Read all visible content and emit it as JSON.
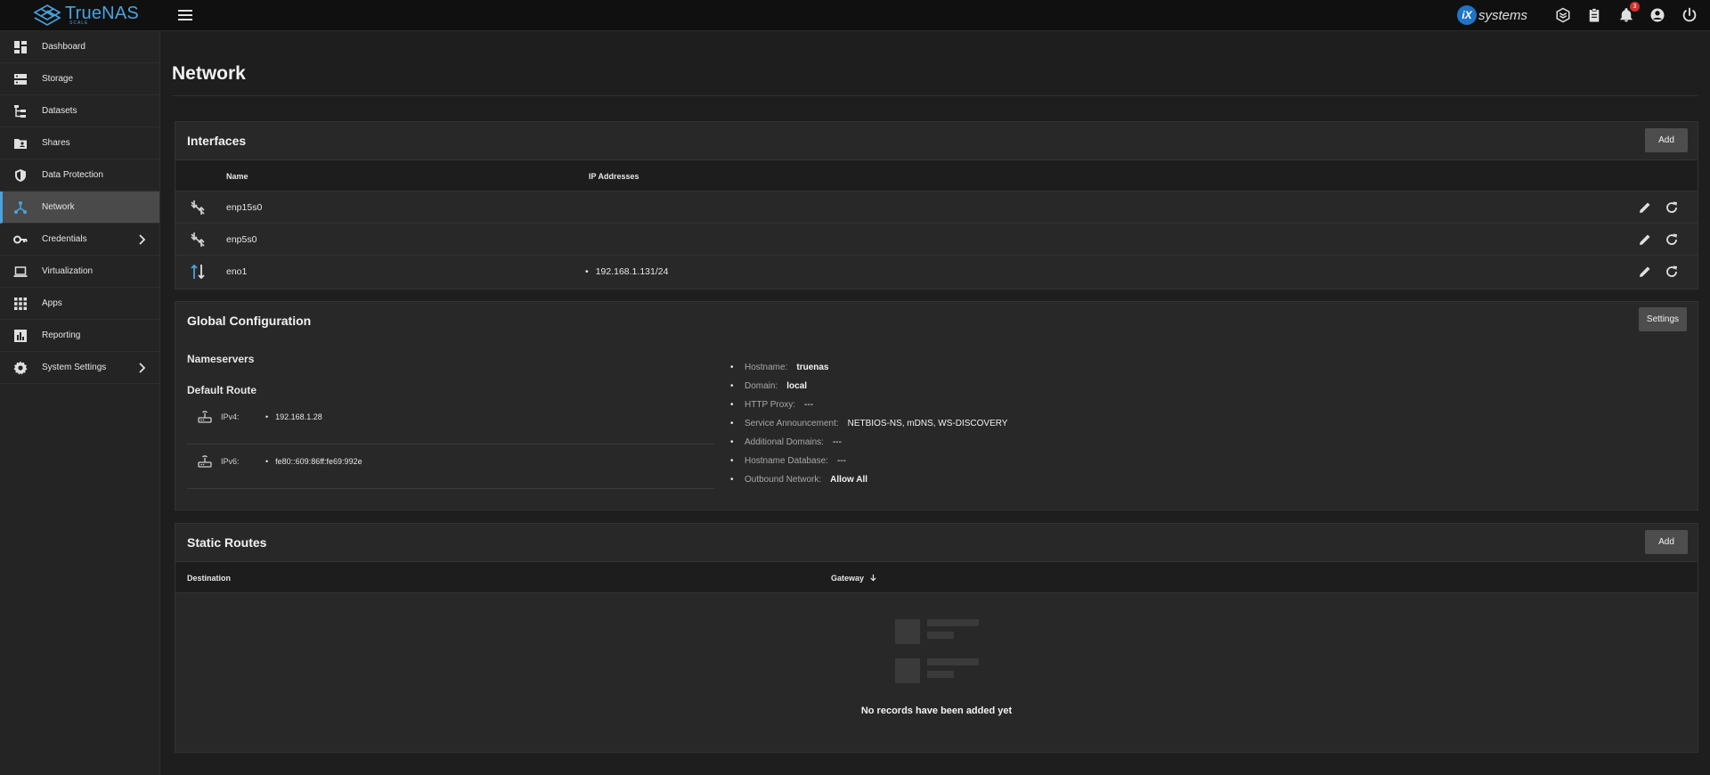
{
  "app": {
    "brand": "TrueNAS",
    "brand_sub": "SCALE",
    "vendor": "iX systems",
    "vendor_badge": "iX",
    "vendor_text": "systems",
    "notification_count": "3"
  },
  "sidebar": {
    "items": [
      {
        "label": "Dashboard",
        "icon": "dashboard-icon"
      },
      {
        "label": "Storage",
        "icon": "storage-icon"
      },
      {
        "label": "Datasets",
        "icon": "datasets-icon"
      },
      {
        "label": "Shares",
        "icon": "shares-icon"
      },
      {
        "label": "Data Protection",
        "icon": "shield-icon"
      },
      {
        "label": "Network",
        "icon": "network-icon",
        "active": true
      },
      {
        "label": "Credentials",
        "icon": "key-icon",
        "has_submenu": true
      },
      {
        "label": "Virtualization",
        "icon": "laptop-icon"
      },
      {
        "label": "Apps",
        "icon": "apps-grid-icon"
      },
      {
        "label": "Reporting",
        "icon": "chart-icon"
      },
      {
        "label": "System Settings",
        "icon": "gear-icon",
        "has_submenu": true
      }
    ]
  },
  "page": {
    "title": "Network"
  },
  "interfaces": {
    "title": "Interfaces",
    "add_label": "Add",
    "columns": {
      "name": "Name",
      "ip": "IP Addresses"
    },
    "rows": [
      {
        "name": "enp15s0",
        "ip": "",
        "status": "link-down"
      },
      {
        "name": "enp5s0",
        "ip": "",
        "status": "link-down"
      },
      {
        "name": "eno1",
        "ip": "192.168.1.131/24",
        "status": "link-up"
      }
    ]
  },
  "global_config": {
    "title": "Global Configuration",
    "settings_label": "Settings",
    "nameservers_label": "Nameservers",
    "default_route_label": "Default Route",
    "ipv4_label": "IPv4:",
    "ipv4_value": "192.168.1.28",
    "ipv6_label": "IPv6:",
    "ipv6_value": "fe80::609:86ff:fe69:992e",
    "info": {
      "hostname": {
        "key": "Hostname:",
        "value": "truenas"
      },
      "domain": {
        "key": "Domain:",
        "value": "local"
      },
      "http_proxy": {
        "key": "HTTP Proxy:",
        "value": "---"
      },
      "service_announcement": {
        "key": "Service Announcement:",
        "value": "NETBIOS-NS, mDNS, WS-DISCOVERY"
      },
      "additional_domains": {
        "key": "Additional Domains:",
        "value": "---"
      },
      "hostname_database": {
        "key": "Hostname Database:",
        "value": "---"
      },
      "outbound_network": {
        "key": "Outbound Network:",
        "value": "Allow All"
      }
    }
  },
  "static_routes": {
    "title": "Static Routes",
    "add_label": "Add",
    "columns": {
      "destination": "Destination",
      "gateway": "Gateway"
    },
    "empty_text": "No records have been added yet"
  },
  "colors": {
    "accent": "#4aa3df",
    "background": "#1e1e1e",
    "card": "#282828",
    "notification": "#d32f2f"
  }
}
